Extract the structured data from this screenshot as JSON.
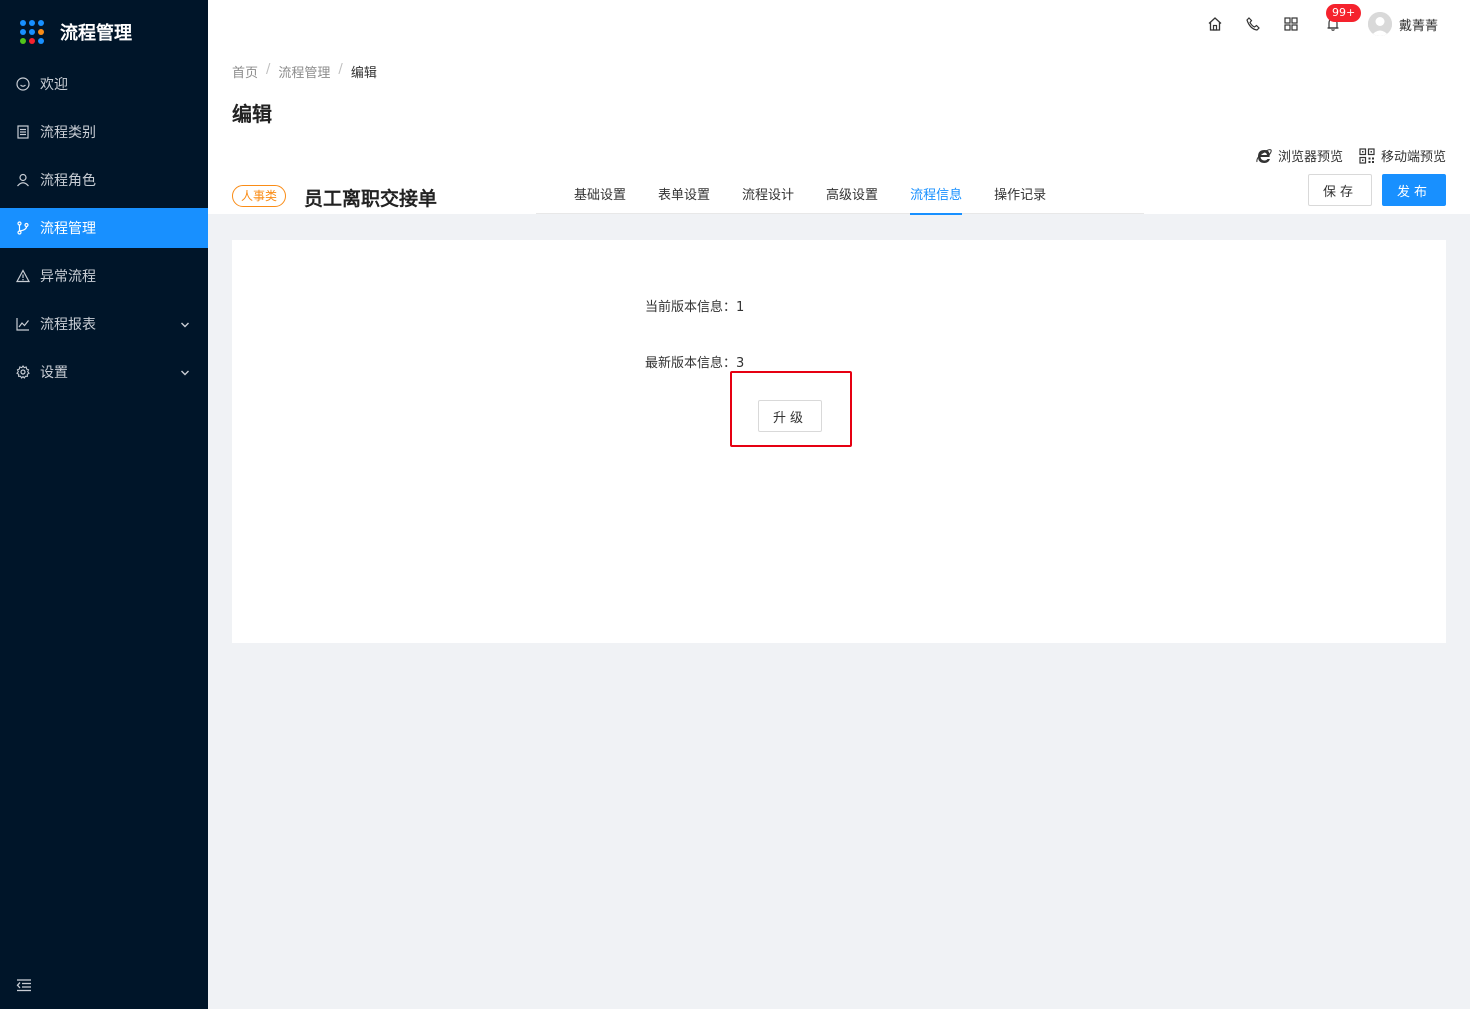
{
  "app": {
    "title": "流程管理"
  },
  "sidebar": {
    "items": [
      {
        "label": "欢迎",
        "icon": "smile-icon",
        "active": false,
        "has_children": false
      },
      {
        "label": "流程类别",
        "icon": "file-list-icon",
        "active": false,
        "has_children": false
      },
      {
        "label": "流程角色",
        "icon": "user-icon",
        "active": false,
        "has_children": false
      },
      {
        "label": "流程管理",
        "icon": "branch-icon",
        "active": true,
        "has_children": false
      },
      {
        "label": "异常流程",
        "icon": "warning-icon",
        "active": false,
        "has_children": false
      },
      {
        "label": "流程报表",
        "icon": "line-chart-icon",
        "active": false,
        "has_children": true
      },
      {
        "label": "设置",
        "icon": "gear-icon",
        "active": false,
        "has_children": true
      }
    ]
  },
  "header": {
    "notification_count": "99+",
    "username": "戴菁菁"
  },
  "breadcrumb": [
    "首页",
    "流程管理",
    "编辑"
  ],
  "page": {
    "title": "编辑",
    "preview_browser": "浏览器预览",
    "preview_mobile": "移动端预览",
    "category_tag": "人事类",
    "form_name": "员工离职交接单",
    "tabs": [
      {
        "label": "基础设置",
        "active": false
      },
      {
        "label": "表单设置",
        "active": false
      },
      {
        "label": "流程设计",
        "active": false
      },
      {
        "label": "高级设置",
        "active": false
      },
      {
        "label": "流程信息",
        "active": true
      },
      {
        "label": "操作记录",
        "active": false
      }
    ],
    "save_label": "保存",
    "publish_label": "发布"
  },
  "content": {
    "current_version_label": "当前版本信息：",
    "current_version": "1",
    "latest_version_label": "最新版本信息：",
    "latest_version": "3",
    "upgrade_label": "升级"
  },
  "colors": {
    "sidebar_bg": "#001529",
    "accent": "#1890ff",
    "tag": "#fa8c16",
    "highlight": "#e60012",
    "badge": "#f5222d"
  }
}
